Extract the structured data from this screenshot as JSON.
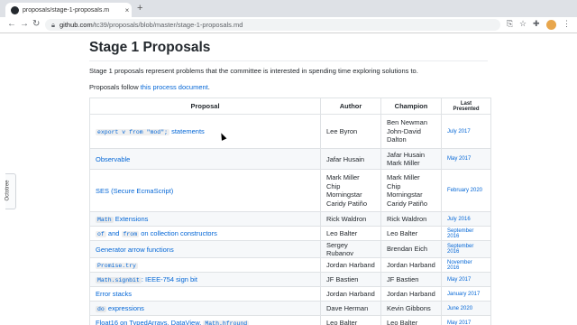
{
  "browser": {
    "tab_title": "proposals/stage-1-proposals.m",
    "url_host": "github.com",
    "url_path": "/tc39/proposals/blob/master/stage-1-proposals.md",
    "new_tab": "+"
  },
  "sidebar": {
    "octotree_label": "Octotree"
  },
  "page": {
    "title": "Stage 1 Proposals",
    "intro": "Stage 1 proposals represent problems that the committee is interested in spending time exploring solutions to.",
    "follow_prefix": "Proposals follow ",
    "follow_link": "this process document",
    "follow_suffix": "."
  },
  "table": {
    "headers": [
      "Proposal",
      "Author",
      "Champion",
      "Last Presented"
    ],
    "rows": [
      {
        "code": "export v from \"mod\";",
        "text": " statements",
        "author": "Lee Byron",
        "champion": [
          "Ben Newman",
          "John-David",
          "Dalton"
        ],
        "date": "July 2017"
      },
      {
        "text": "Observable",
        "author": "Jafar Husain",
        "champion": [
          "Jafar Husain",
          "Mark Miller"
        ],
        "date": "May 2017"
      },
      {
        "text": "SES (Secure EcmaScript)",
        "author": [
          "Mark Miller",
          "Chip",
          "Morningstar",
          "Caridy Patiño"
        ],
        "champion": [
          "Mark Miller",
          "Chip",
          "Morningstar",
          "Caridy Patiño"
        ],
        "date": "February 2020"
      },
      {
        "code": "Math",
        "text": " Extensions",
        "author": "Rick Waldron",
        "champion": [
          "Rick Waldron"
        ],
        "date": "July 2016"
      },
      {
        "code": "of",
        "mid": " and ",
        "code2": "from",
        "text": " on collection constructors",
        "author": "Leo Balter",
        "champion": [
          "Leo Balter"
        ],
        "date": "September 2016"
      },
      {
        "text": "Generator arrow functions",
        "author": "Sergey Rubanov",
        "champion": [
          "Brendan Eich"
        ],
        "date": "September 2016"
      },
      {
        "code": "Promise.try",
        "text": "",
        "author": "Jordan Harband",
        "champion": [
          "Jordan Harband"
        ],
        "date": "November 2016"
      },
      {
        "code": "Math.signbit",
        "text": ": IEEE-754 sign bit",
        "author": "JF Bastien",
        "champion": [
          "JF Bastien"
        ],
        "date": "May 2017"
      },
      {
        "text": "Error stacks",
        "author": "Jordan Harband",
        "champion": [
          "Jordan Harband"
        ],
        "date": "January 2017"
      },
      {
        "code": "do",
        "text": " expressions",
        "author": "Dave Herman",
        "champion": [
          "Kevin Gibbons"
        ],
        "date": "June 2020"
      },
      {
        "text": "Float16 on TypedArrays, DataView, ",
        "code": "Math.hfround",
        "author": "Leo Balter",
        "champion": [
          "Leo Balter"
        ],
        "date": "May 2017"
      }
    ]
  }
}
